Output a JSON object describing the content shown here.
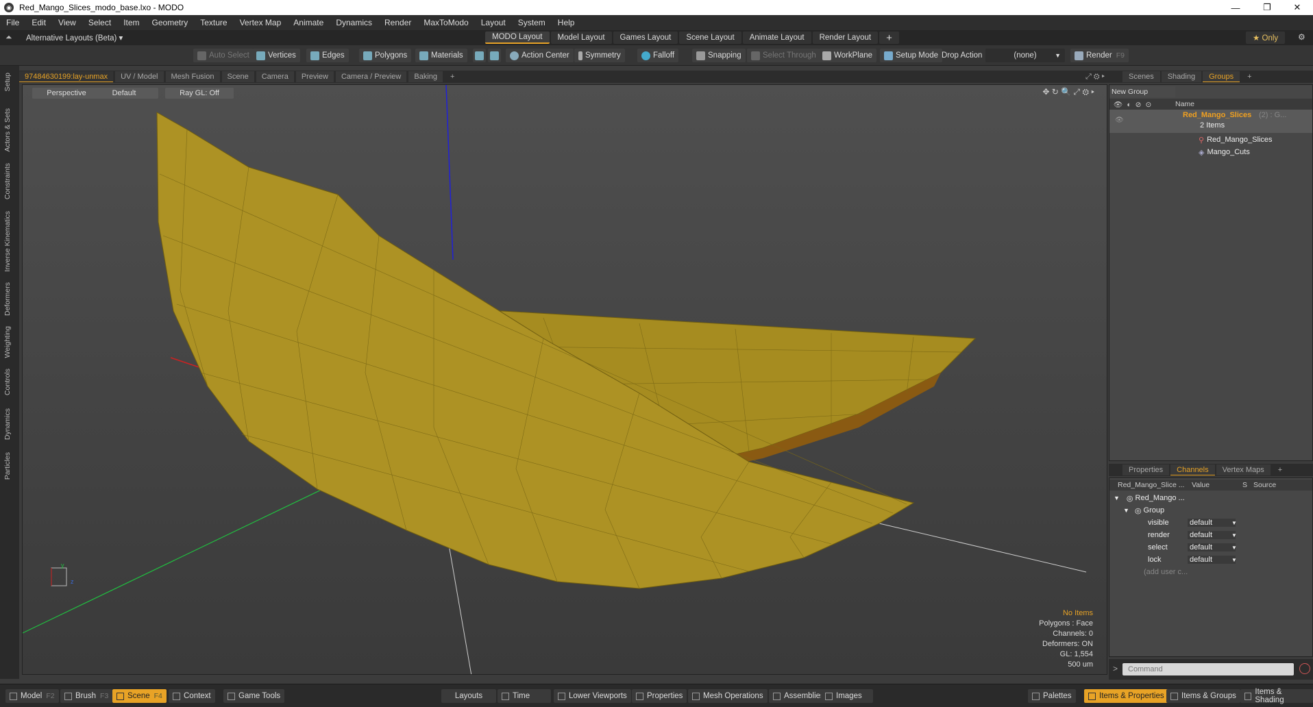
{
  "window": {
    "title": "Red_Mango_Slices_modo_base.lxo - MODO"
  },
  "menu": [
    "File",
    "Edit",
    "View",
    "Select",
    "Item",
    "Geometry",
    "Texture",
    "Vertex Map",
    "Animate",
    "Dynamics",
    "Render",
    "MaxToModo",
    "Layout",
    "System",
    "Help"
  ],
  "layouts": {
    "alt_label": "Alternative Layouts (Beta) ▾",
    "tabs": [
      "MODO Layout",
      "Model Layout",
      "Games Layout",
      "Scene Layout",
      "Animate Layout",
      "Render Layout"
    ],
    "only_label": "★ Only"
  },
  "toolbar": {
    "auto_select": "Auto Select",
    "vertices": "Vertices",
    "edges": "Edges",
    "polygons": "Polygons",
    "materials": "Materials",
    "action_center": "Action Center",
    "symmetry": "Symmetry",
    "falloff": "Falloff",
    "snapping": "Snapping",
    "select_through": "Select Through",
    "workplane": "WorkPlane",
    "setup_mode": "Setup Mode",
    "drop_action": "Drop Action",
    "drop_value": "(none)",
    "render": "Render",
    "render_key": "F9"
  },
  "left_tabs": [
    "Setup",
    "Actors & Sets",
    "Constraints",
    "Inverse Kinematics",
    "Deformers",
    "Weighting",
    "Controls",
    "Dynamics",
    "Particles"
  ],
  "viewport_tabs": [
    "97484630199:lay-unmax",
    "UV / Model",
    "Mesh Fusion",
    "Scene",
    "Camera",
    "Preview",
    "Camera / Preview",
    "Baking"
  ],
  "viewport": {
    "perspective": "Perspective",
    "default": "Default",
    "raygl": "Ray GL: Off",
    "info": {
      "items": "No Items",
      "polygons": "Polygons : Face",
      "channels": "Channels: 0",
      "deformers": "Deformers: ON",
      "gl": "GL: 1,554",
      "units": "500 um"
    },
    "colors": {
      "mesh": "#a88e22",
      "mesh_edge": "#6f5d10",
      "x_axis": "#d02020",
      "y_axis": "#2020d8",
      "z_axis": "#20c040"
    }
  },
  "groups_panel": {
    "tabs": [
      "Scenes",
      "Shading",
      "Groups"
    ],
    "new_group": "New Group",
    "col_name": "Name",
    "group_name": "Red_Mango_Slices",
    "group_suffix": "(2) : G...",
    "group_count": "2 Items",
    "children": [
      "Red_Mango_Slices",
      "Mango_Cuts"
    ]
  },
  "channels_panel": {
    "tabs": [
      "Properties",
      "Channels",
      "Vertex Maps"
    ],
    "col_item": "Red_Mango_Slice ...",
    "col_value": "Value",
    "col_s": "S",
    "col_source": "Source",
    "root": "Red_Mango ...",
    "group": "Group",
    "rows": [
      {
        "name": "visible",
        "value": "default"
      },
      {
        "name": "render",
        "value": "default"
      },
      {
        "name": "select",
        "value": "default"
      },
      {
        "name": "lock",
        "value": "default"
      }
    ],
    "add_user": "(add user c...",
    "command_placeholder": "Command"
  },
  "bottom": {
    "model": "Model",
    "model_key": "F2",
    "brush": "Brush",
    "brush_key": "F3",
    "scene": "Scene",
    "scene_key": "F4",
    "context": "Context",
    "game_tools": "Game Tools",
    "layouts": "Layouts",
    "time": "Time",
    "lower_viewports": "Lower Viewports",
    "properties": "Properties",
    "mesh_operations": "Mesh Operations",
    "assemblies": "Assemblies",
    "images": "Images",
    "palettes": "Palettes",
    "items_properties": "Items & Properties",
    "items_groups": "Items & Groups",
    "items_shading": "Items & Shading"
  }
}
